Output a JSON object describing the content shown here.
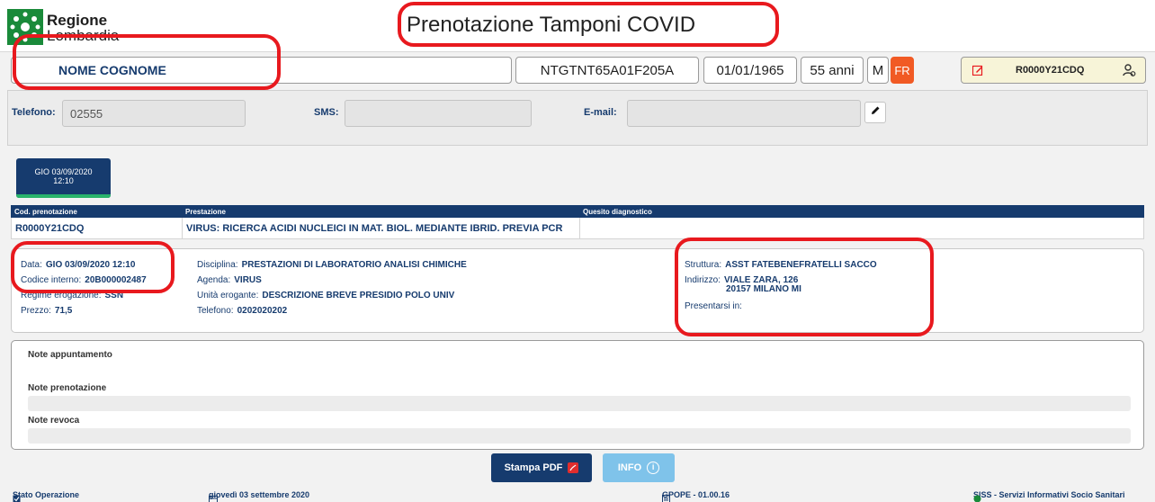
{
  "header": {
    "brand_line1": "Regione",
    "brand_line2": "Lombardia",
    "title": "Prenotazione Tamponi COVID"
  },
  "patient": {
    "name": "NOME COGNOME",
    "codice_fiscale": "NTGTNT65A01F205A",
    "birth_date": "01/01/1965",
    "age": "55 anni",
    "sex": "M",
    "badge": "FR",
    "booking_code": "R0000Y21CDQ"
  },
  "contact": {
    "telefono_label": "Telefono:",
    "telefono_value": "02555",
    "sms_label": "SMS:",
    "sms_value": "",
    "email_label": "E-mail:",
    "email_value": ""
  },
  "date_tab": {
    "line1": "GIO 03/09/2020",
    "line2": "12:10"
  },
  "table": {
    "headers": [
      "Cod. prenotazione",
      "Prestazione",
      "Quesito diagnostico"
    ],
    "rows": [
      [
        "R0000Y21CDQ",
        "VIRUS: RICERCA ACIDI NUCLEICI IN MAT. BIOL. MEDIANTE IBRID. PREVIA PCR",
        ""
      ]
    ]
  },
  "detail": {
    "col1": [
      {
        "label": "Data:",
        "value": "GIO 03/09/2020 12:10"
      },
      {
        "label": "Codice interno:",
        "value": "20B000002487"
      },
      {
        "label": "Regime erogazione:",
        "value": "SSN"
      },
      {
        "label": "Prezzo:",
        "value": "71,5"
      }
    ],
    "col2": [
      {
        "label": "Disciplina:",
        "value": "PRESTAZIONI DI LABORATORIO ANALISI CHIMICHE"
      },
      {
        "label": "Agenda:",
        "value": "VIRUS"
      },
      {
        "label": "Unità erogante:",
        "value": "DESCRIZIONE BREVE PRESIDIO POLO UNIV"
      },
      {
        "label": "Telefono:",
        "value": "0202020202"
      }
    ],
    "col3": {
      "struttura_label": "Struttura:",
      "struttura_value": "ASST FATEBENEFRATELLI SACCO",
      "indirizzo_label": "Indirizzo:",
      "indirizzo_line1": "VIALE ZARA, 126",
      "indirizzo_line2": "20157 MILANO MI",
      "presentarsi_label": "Presentarsi in:"
    }
  },
  "notes": {
    "appuntamento": "Note appuntamento",
    "prenotazione": "Note prenotazione",
    "revoca": "Note revoca"
  },
  "buttons": {
    "pdf": "Stampa PDF",
    "info": "INFO"
  },
  "status_bar": {
    "stato": "Stato Operazione",
    "date": "giovedì 03 settembre 2020",
    "version": "GPOPE - 01.00.16",
    "siss": "SISS - Servizi Informativi Socio Sanitari"
  },
  "colors": {
    "primary": "#163b6e",
    "accent_green": "#29b36b",
    "brand_green": "#1a8a3a",
    "fr_orange": "#f15a24",
    "annotation_red": "#e8191e"
  }
}
